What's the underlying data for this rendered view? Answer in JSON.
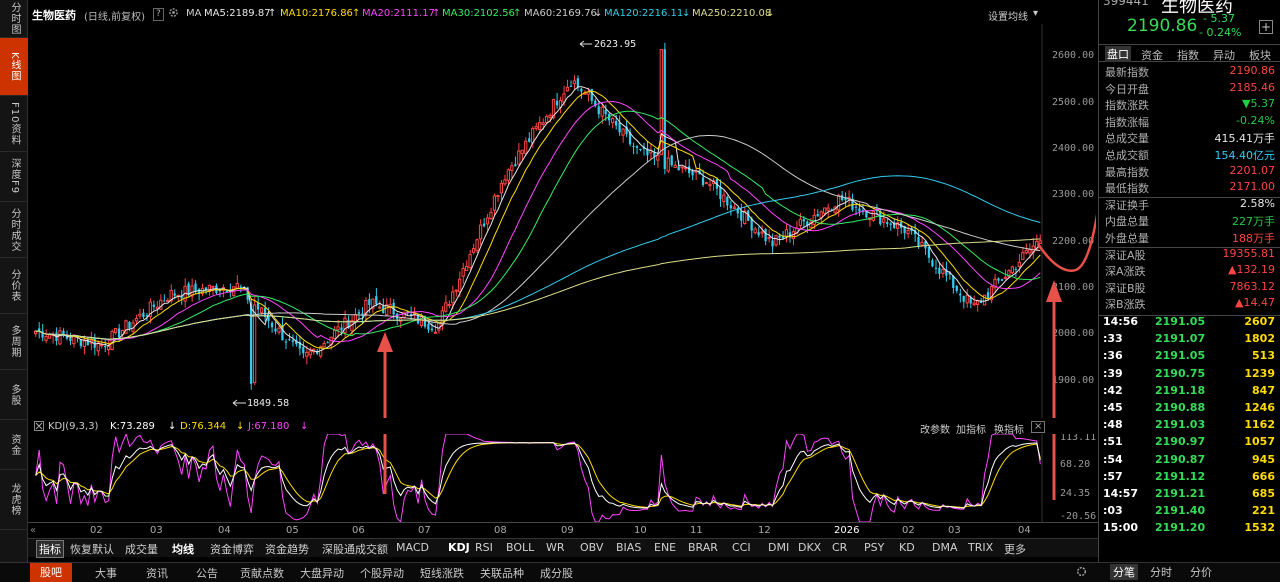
{
  "left_nav": [
    {
      "label": "分时图",
      "active": false
    },
    {
      "label": "K线图",
      "active": true
    },
    {
      "label": "F10资料",
      "active": false
    },
    {
      "label": "深度F9",
      "active": false
    },
    {
      "label": "分时成交",
      "active": false
    },
    {
      "label": "分价表",
      "active": false
    },
    {
      "label": "多周期",
      "active": false
    },
    {
      "label": "多股",
      "active": false
    },
    {
      "label": "资金",
      "active": false
    },
    {
      "label": "龙虎榜",
      "active": false
    }
  ],
  "chart_header": {
    "title": "生物医药",
    "mode": "(日线,前复权)",
    "help": "?",
    "ma_label": "MA",
    "ma5": "MA5:2189.87",
    "ma10": "MA10:2176.86",
    "ma20": "MA20:2111.17",
    "ma30": "MA30:2102.56",
    "ma60": "MA60:2169.76",
    "ma120": "MA120:2216.11",
    "ma250": "MA250:2210.08",
    "settings": "设置均线",
    "colors": {
      "ma5": "#e8e8e8",
      "ma10": "#ffdd00",
      "ma20": "#ff44ff",
      "ma30": "#33ee66",
      "ma60": "#cccccc",
      "ma120": "#33ccee",
      "ma250": "#dddd88"
    }
  },
  "kdj_header": {
    "name": "KDJ(9,3,3)",
    "k": "K:73.289",
    "d": "D:76.344",
    "j": "J:67.180",
    "btn1": "改参数",
    "btn2": "加指标",
    "btn3": "换指标",
    "close": "×"
  },
  "chart_data": [
    {
      "type": "candlestick",
      "title": "生物医药",
      "y_ticks": [
        "2600.00",
        "2500.00",
        "2400.00",
        "2300.00",
        "2200.00",
        "2100.00",
        "2000.00",
        "1900.00"
      ],
      "ylim": [
        1800,
        2660
      ],
      "annotations": [
        {
          "label": "2623.95",
          "type": "high",
          "value": 2623.95
        },
        {
          "label": "1849.58",
          "type": "low",
          "value": 1849.58
        }
      ],
      "month_labels": [
        "02",
        "03",
        "04",
        "05",
        "06",
        "07",
        "08",
        "09",
        "10",
        "11",
        "12",
        "2026",
        "02",
        "03",
        "04"
      ],
      "monthly_closes": [
        1960,
        2070,
        2090,
        1930,
        2050,
        2000,
        2330,
        2540,
        2380,
        2320,
        2180,
        2280,
        2210,
        2040,
        2190
      ],
      "series": [
        {
          "name": "MA5",
          "color": "#e8e8e8"
        },
        {
          "name": "MA10",
          "color": "#ffdd00"
        },
        {
          "name": "MA20",
          "color": "#ff44ff"
        },
        {
          "name": "MA30",
          "color": "#33ee66"
        },
        {
          "name": "MA60",
          "color": "#cccccc"
        },
        {
          "name": "MA120",
          "color": "#33ccee"
        },
        {
          "name": "MA250",
          "color": "#dddd88"
        }
      ]
    },
    {
      "type": "line",
      "title": "KDJ(9,3,3)",
      "y_ticks": [
        "113.11",
        "68.20",
        "24.35",
        "-20.56"
      ],
      "ylim": [
        -20.56,
        113.11
      ],
      "series": [
        {
          "name": "K",
          "value": 73.289,
          "color": "#ffffff"
        },
        {
          "name": "D",
          "value": 76.344,
          "color": "#ffdd00"
        },
        {
          "name": "J",
          "value": 67.18,
          "color": "#ff44ff"
        }
      ]
    }
  ],
  "indicator_tabs": [
    "指标",
    "恢复默认",
    "成交量",
    "均线",
    "资金博弈",
    "资金趋势",
    "深股通成交额",
    "MACD",
    "KDJ",
    "RSI",
    "BOLL",
    "WR",
    "OBV",
    "BIAS",
    "ENE",
    "BRAR",
    "CCI",
    "DMI",
    "DKX",
    "CR",
    "PSY",
    "KD",
    "DMA",
    "TRIX",
    "更多"
  ],
  "bottom_tabs": [
    "股吧",
    "大事",
    "资讯",
    "公告",
    "贡献点数",
    "大盘异动",
    "个股异动",
    "短线涨跌",
    "关联品种",
    "成分股"
  ],
  "right_panel": {
    "title": "生物医药",
    "code": "399441",
    "price": "2190.86",
    "change": "- 5.37",
    "change_pct": "- 0.24%",
    "add": "+",
    "tabs": [
      "盘口",
      "资金",
      "指数",
      "异动",
      "板块"
    ],
    "quote_rows": [
      {
        "label": "最新指数",
        "value": "2190.86",
        "color": "red"
      },
      {
        "label": "今日开盘",
        "value": "2185.46",
        "color": "red"
      },
      {
        "label": "指数涨跌",
        "value": "▼5.37",
        "color": "green"
      },
      {
        "label": "指数涨幅",
        "value": "-0.24%",
        "color": "green"
      },
      {
        "label": "总成交量",
        "value": "415.41万手",
        "color": "white"
      },
      {
        "label": "总成交额",
        "value": "154.40亿元",
        "color": "cyan"
      },
      {
        "label": "最高指数",
        "value": "2201.07",
        "color": "red"
      },
      {
        "label": "最低指数",
        "value": "2171.00",
        "color": "red"
      },
      {
        "label": "深证换手",
        "value": "2.58%",
        "color": "white"
      },
      {
        "label": "内盘总量",
        "value": "227万手",
        "color": "green"
      },
      {
        "label": "外盘总量",
        "value": "188万手",
        "color": "red"
      },
      {
        "label": "深证A股",
        "value": "19355.81",
        "color": "red"
      },
      {
        "label": "深A涨跌",
        "value": "▲132.19",
        "color": "red"
      },
      {
        "label": "深证B股",
        "value": "7863.12",
        "color": "red"
      },
      {
        "label": "深B涨跌",
        "value": "▲14.47",
        "color": "red"
      }
    ],
    "ticks": [
      {
        "time": "14:56",
        "price": "2191.05",
        "vol": "2607"
      },
      {
        "time": ":33",
        "price": "2191.07",
        "vol": "1802"
      },
      {
        "time": ":36",
        "price": "2191.05",
        "vol": "513"
      },
      {
        "time": ":39",
        "price": "2190.75",
        "vol": "1239"
      },
      {
        "time": ":42",
        "price": "2191.18",
        "vol": "847"
      },
      {
        "time": ":45",
        "price": "2190.88",
        "vol": "1246"
      },
      {
        "time": ":48",
        "price": "2191.03",
        "vol": "1162"
      },
      {
        "time": ":51",
        "price": "2190.97",
        "vol": "1057"
      },
      {
        "time": ":54",
        "price": "2190.87",
        "vol": "945"
      },
      {
        "time": ":57",
        "price": "2191.12",
        "vol": "666"
      },
      {
        "time": "14:57",
        "price": "2191.21",
        "vol": "685"
      },
      {
        "time": ":03",
        "price": "2191.40",
        "vol": "221"
      },
      {
        "time": "15:00",
        "price": "2191.20",
        "vol": "1532"
      }
    ],
    "bottom_tabs": [
      "分笔",
      "分时",
      "分价"
    ]
  }
}
